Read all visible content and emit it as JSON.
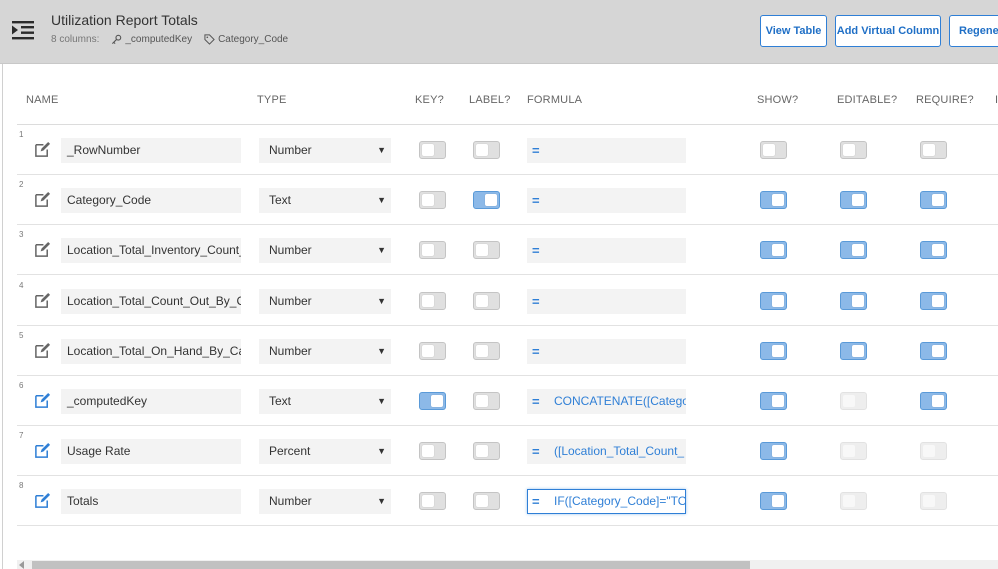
{
  "header": {
    "title": "Utilization Report Totals",
    "columns_count": "8 columns:",
    "key_label": "_computedKey",
    "label_label": "Category_Code",
    "buttons": {
      "view_table": "View Table",
      "add_virtual_column": "Add Virtual Column",
      "regenerate": "Regenera"
    }
  },
  "columns": {
    "name": "NAME",
    "type": "TYPE",
    "key": "KEY?",
    "label": "LABEL?",
    "formula": "FORMULA",
    "show": "SHOW?",
    "editable": "EDITABLE?",
    "require": "REQUIRE?",
    "extra": "I"
  },
  "colors": {
    "accent": "#2f7fd6",
    "toggle_on": "#8cb9e8",
    "header_bg": "#d6d6d6"
  },
  "rows": [
    {
      "num": "1",
      "name": "_RowNumber",
      "type": "Number",
      "key": false,
      "label": false,
      "formula": "",
      "show": false,
      "editable": false,
      "require": false,
      "editable_disabled": false,
      "require_disabled": false,
      "edit_active": false
    },
    {
      "num": "2",
      "name": "Category_Code",
      "type": "Text",
      "key": false,
      "label": true,
      "formula": "",
      "show": true,
      "editable": true,
      "require": true,
      "editable_disabled": false,
      "require_disabled": false,
      "edit_active": false
    },
    {
      "num": "3",
      "name": "Location_Total_Inventory_Count_",
      "type": "Number",
      "key": false,
      "label": false,
      "formula": "",
      "show": true,
      "editable": true,
      "require": true,
      "editable_disabled": false,
      "require_disabled": false,
      "edit_active": false
    },
    {
      "num": "4",
      "name": "Location_Total_Count_Out_By_C",
      "type": "Number",
      "key": false,
      "label": false,
      "formula": "",
      "show": true,
      "editable": true,
      "require": true,
      "editable_disabled": false,
      "require_disabled": false,
      "edit_active": false
    },
    {
      "num": "5",
      "name": "Location_Total_On_Hand_By_Ca",
      "type": "Number",
      "key": false,
      "label": false,
      "formula": "",
      "show": true,
      "editable": true,
      "require": true,
      "editable_disabled": false,
      "require_disabled": false,
      "edit_active": false
    },
    {
      "num": "6",
      "name": "_computedKey",
      "type": "Text",
      "key": true,
      "label": false,
      "formula": "CONCATENATE([Catego",
      "show": true,
      "editable": false,
      "require": true,
      "editable_disabled": true,
      "require_disabled": false,
      "edit_active": true
    },
    {
      "num": "7",
      "name": "Usage Rate",
      "type": "Percent",
      "key": false,
      "label": false,
      "formula": "([Location_Total_Count_",
      "show": true,
      "editable": false,
      "require": false,
      "editable_disabled": true,
      "require_disabled": true,
      "edit_active": true
    },
    {
      "num": "8",
      "name": "Totals",
      "type": "Number",
      "key": false,
      "label": false,
      "formula": "IF([Category_Code]=\"TO",
      "show": true,
      "editable": false,
      "require": false,
      "editable_disabled": true,
      "require_disabled": true,
      "edit_active": true,
      "formula_focused": true
    }
  ]
}
